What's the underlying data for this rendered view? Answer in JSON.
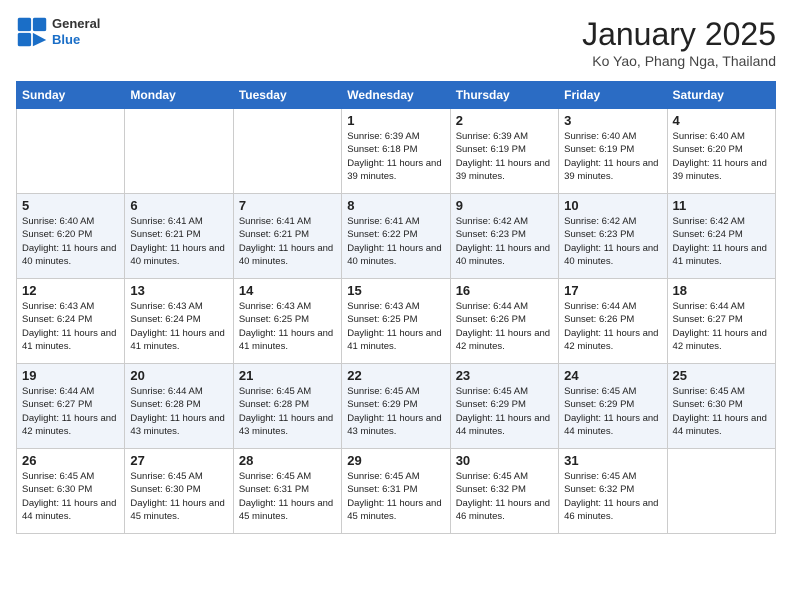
{
  "header": {
    "logo_general": "General",
    "logo_blue": "Blue",
    "title": "January 2025",
    "subtitle": "Ko Yao, Phang Nga, Thailand"
  },
  "columns": [
    "Sunday",
    "Monday",
    "Tuesday",
    "Wednesday",
    "Thursday",
    "Friday",
    "Saturday"
  ],
  "weeks": [
    [
      {
        "day": "",
        "info": ""
      },
      {
        "day": "",
        "info": ""
      },
      {
        "day": "",
        "info": ""
      },
      {
        "day": "1",
        "info": "Sunrise: 6:39 AM\nSunset: 6:18 PM\nDaylight: 11 hours and 39 minutes."
      },
      {
        "day": "2",
        "info": "Sunrise: 6:39 AM\nSunset: 6:19 PM\nDaylight: 11 hours and 39 minutes."
      },
      {
        "day": "3",
        "info": "Sunrise: 6:40 AM\nSunset: 6:19 PM\nDaylight: 11 hours and 39 minutes."
      },
      {
        "day": "4",
        "info": "Sunrise: 6:40 AM\nSunset: 6:20 PM\nDaylight: 11 hours and 39 minutes."
      }
    ],
    [
      {
        "day": "5",
        "info": "Sunrise: 6:40 AM\nSunset: 6:20 PM\nDaylight: 11 hours and 40 minutes."
      },
      {
        "day": "6",
        "info": "Sunrise: 6:41 AM\nSunset: 6:21 PM\nDaylight: 11 hours and 40 minutes."
      },
      {
        "day": "7",
        "info": "Sunrise: 6:41 AM\nSunset: 6:21 PM\nDaylight: 11 hours and 40 minutes."
      },
      {
        "day": "8",
        "info": "Sunrise: 6:41 AM\nSunset: 6:22 PM\nDaylight: 11 hours and 40 minutes."
      },
      {
        "day": "9",
        "info": "Sunrise: 6:42 AM\nSunset: 6:23 PM\nDaylight: 11 hours and 40 minutes."
      },
      {
        "day": "10",
        "info": "Sunrise: 6:42 AM\nSunset: 6:23 PM\nDaylight: 11 hours and 40 minutes."
      },
      {
        "day": "11",
        "info": "Sunrise: 6:42 AM\nSunset: 6:24 PM\nDaylight: 11 hours and 41 minutes."
      }
    ],
    [
      {
        "day": "12",
        "info": "Sunrise: 6:43 AM\nSunset: 6:24 PM\nDaylight: 11 hours and 41 minutes."
      },
      {
        "day": "13",
        "info": "Sunrise: 6:43 AM\nSunset: 6:24 PM\nDaylight: 11 hours and 41 minutes."
      },
      {
        "day": "14",
        "info": "Sunrise: 6:43 AM\nSunset: 6:25 PM\nDaylight: 11 hours and 41 minutes."
      },
      {
        "day": "15",
        "info": "Sunrise: 6:43 AM\nSunset: 6:25 PM\nDaylight: 11 hours and 41 minutes."
      },
      {
        "day": "16",
        "info": "Sunrise: 6:44 AM\nSunset: 6:26 PM\nDaylight: 11 hours and 42 minutes."
      },
      {
        "day": "17",
        "info": "Sunrise: 6:44 AM\nSunset: 6:26 PM\nDaylight: 11 hours and 42 minutes."
      },
      {
        "day": "18",
        "info": "Sunrise: 6:44 AM\nSunset: 6:27 PM\nDaylight: 11 hours and 42 minutes."
      }
    ],
    [
      {
        "day": "19",
        "info": "Sunrise: 6:44 AM\nSunset: 6:27 PM\nDaylight: 11 hours and 42 minutes."
      },
      {
        "day": "20",
        "info": "Sunrise: 6:44 AM\nSunset: 6:28 PM\nDaylight: 11 hours and 43 minutes."
      },
      {
        "day": "21",
        "info": "Sunrise: 6:45 AM\nSunset: 6:28 PM\nDaylight: 11 hours and 43 minutes."
      },
      {
        "day": "22",
        "info": "Sunrise: 6:45 AM\nSunset: 6:29 PM\nDaylight: 11 hours and 43 minutes."
      },
      {
        "day": "23",
        "info": "Sunrise: 6:45 AM\nSunset: 6:29 PM\nDaylight: 11 hours and 44 minutes."
      },
      {
        "day": "24",
        "info": "Sunrise: 6:45 AM\nSunset: 6:29 PM\nDaylight: 11 hours and 44 minutes."
      },
      {
        "day": "25",
        "info": "Sunrise: 6:45 AM\nSunset: 6:30 PM\nDaylight: 11 hours and 44 minutes."
      }
    ],
    [
      {
        "day": "26",
        "info": "Sunrise: 6:45 AM\nSunset: 6:30 PM\nDaylight: 11 hours and 44 minutes."
      },
      {
        "day": "27",
        "info": "Sunrise: 6:45 AM\nSunset: 6:30 PM\nDaylight: 11 hours and 45 minutes."
      },
      {
        "day": "28",
        "info": "Sunrise: 6:45 AM\nSunset: 6:31 PM\nDaylight: 11 hours and 45 minutes."
      },
      {
        "day": "29",
        "info": "Sunrise: 6:45 AM\nSunset: 6:31 PM\nDaylight: 11 hours and 45 minutes."
      },
      {
        "day": "30",
        "info": "Sunrise: 6:45 AM\nSunset: 6:32 PM\nDaylight: 11 hours and 46 minutes."
      },
      {
        "day": "31",
        "info": "Sunrise: 6:45 AM\nSunset: 6:32 PM\nDaylight: 11 hours and 46 minutes."
      },
      {
        "day": "",
        "info": ""
      }
    ]
  ]
}
